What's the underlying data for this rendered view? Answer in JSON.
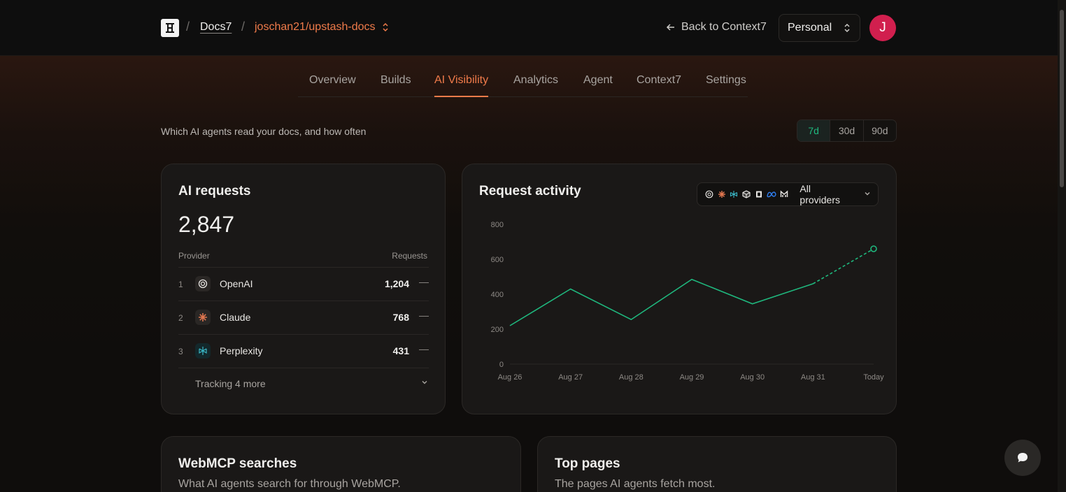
{
  "header": {
    "breadcrumb_project": "Docs7",
    "breadcrumb_repo": "joschan21/upstash-docs",
    "back_link": "Back to Context7",
    "account_switcher": "Personal",
    "avatar_initial": "J"
  },
  "tabs": [
    {
      "label": "Overview",
      "active": false
    },
    {
      "label": "Builds",
      "active": false
    },
    {
      "label": "AI Visibility",
      "active": true
    },
    {
      "label": "Analytics",
      "active": false
    },
    {
      "label": "Agent",
      "active": false
    },
    {
      "label": "Context7",
      "active": false
    },
    {
      "label": "Settings",
      "active": false
    }
  ],
  "page": {
    "subtitle": "Which AI agents read your docs, and how often",
    "ranges": [
      {
        "label": "7d",
        "active": true
      },
      {
        "label": "30d",
        "active": false
      },
      {
        "label": "90d",
        "active": false
      }
    ]
  },
  "ai_requests": {
    "title": "AI requests",
    "total": "2,847",
    "col_provider": "Provider",
    "col_requests": "Requests",
    "providers": [
      {
        "rank": "1",
        "name": "OpenAI",
        "value": "1,204",
        "trend": "—",
        "icon": "openai-icon"
      },
      {
        "rank": "2",
        "name": "Claude",
        "value": "768",
        "trend": "—",
        "icon": "claude-icon"
      },
      {
        "rank": "3",
        "name": "Perplexity",
        "value": "431",
        "trend": "—",
        "icon": "perplexity-icon"
      }
    ],
    "more_label": "Tracking 4 more"
  },
  "request_activity": {
    "title": "Request activity",
    "filter_label": "All providers",
    "filter_icons": [
      "openai-icon",
      "claude-icon",
      "perplexity-icon",
      "cube-icon",
      "notion-icon",
      "meta-icon",
      "mistral-icon"
    ]
  },
  "chart_data": {
    "type": "line",
    "x": [
      "Aug 26",
      "Aug 27",
      "Aug 28",
      "Aug 29",
      "Aug 30",
      "Aug 31",
      "Today"
    ],
    "series": [
      {
        "values": [
          220,
          430,
          255,
          485,
          345,
          460,
          660
        ],
        "projected_from_index": 5
      }
    ],
    "ylim": [
      0,
      800
    ],
    "yticks": [
      0,
      200,
      400,
      600,
      800
    ],
    "color": "#1fb87e",
    "grid": false
  },
  "webmcp": {
    "title": "WebMCP searches",
    "subtitle": "What AI agents search for through WebMCP."
  },
  "top_pages": {
    "title": "Top pages",
    "subtitle": "The pages AI agents fetch most."
  },
  "colors": {
    "accent": "#f07b4a",
    "chart_line": "#1fb87e",
    "avatar": "#d11f4e"
  }
}
